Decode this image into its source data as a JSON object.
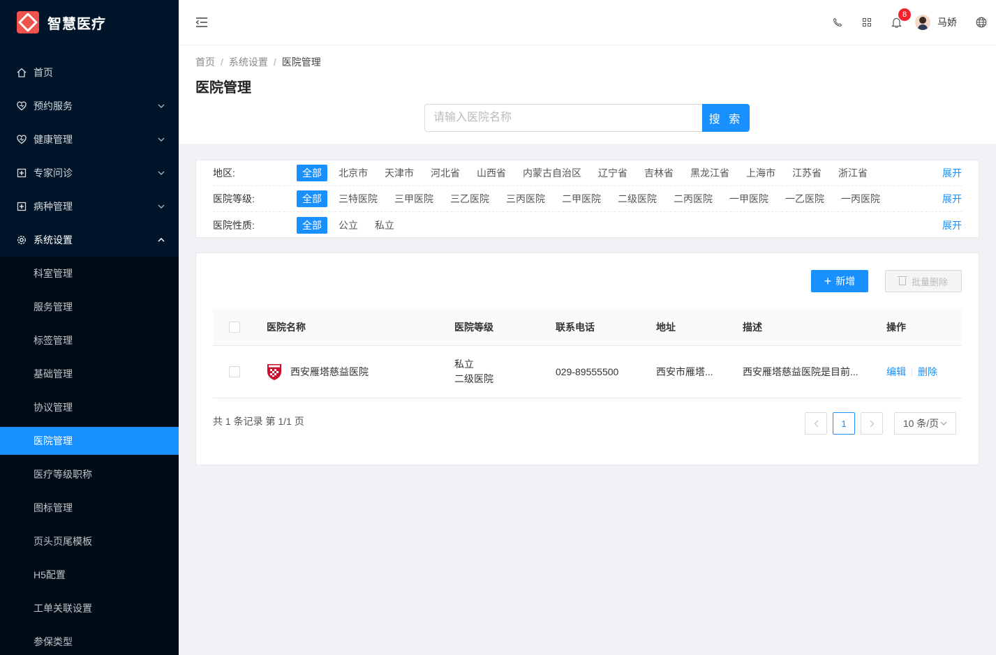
{
  "app": {
    "title": "智慧医疗"
  },
  "sidebar": {
    "items": [
      {
        "label": "首页",
        "icon": "home-icon"
      },
      {
        "label": "预约服务",
        "icon": "heart-shield-icon"
      },
      {
        "label": "健康管理",
        "icon": "heart-pulse-icon"
      },
      {
        "label": "专家问诊",
        "icon": "medical-plus-icon"
      },
      {
        "label": "病种管理",
        "icon": "medical-plus-icon"
      },
      {
        "label": "系统设置",
        "icon": "gear-icon"
      }
    ],
    "sub_items": [
      {
        "label": "科室管理"
      },
      {
        "label": "服务管理"
      },
      {
        "label": "标签管理"
      },
      {
        "label": "基础管理"
      },
      {
        "label": "协议管理"
      },
      {
        "label": "医院管理",
        "active": true
      },
      {
        "label": "医疗等级职称"
      },
      {
        "label": "图标管理"
      },
      {
        "label": "页头页尾模板"
      },
      {
        "label": "H5配置"
      },
      {
        "label": "工单关联设置"
      },
      {
        "label": "参保类型"
      }
    ]
  },
  "header": {
    "notification_count": "8",
    "user_name": "马娇"
  },
  "breadcrumb": {
    "home": "首页",
    "parent": "系统设置",
    "current": "医院管理"
  },
  "page": {
    "title": "医院管理"
  },
  "search": {
    "placeholder": "请输入医院名称",
    "button": "搜 索"
  },
  "filters": {
    "region": {
      "label": "地区:",
      "options": [
        "全部",
        "北京市",
        "天津市",
        "河北省",
        "山西省",
        "内蒙古自治区",
        "辽宁省",
        "吉林省",
        "黑龙江省",
        "上海市",
        "江苏省",
        "浙江省"
      ],
      "expand": "展开"
    },
    "level": {
      "label": "医院等级:",
      "options": [
        "全部",
        "三特医院",
        "三甲医院",
        "三乙医院",
        "三丙医院",
        "二甲医院",
        "二级医院",
        "二丙医院",
        "一甲医院",
        "一乙医院",
        "一丙医院"
      ],
      "expand": "展开"
    },
    "nature": {
      "label": "医院性质:",
      "options": [
        "全部",
        "公立",
        "私立"
      ],
      "expand": "展开"
    }
  },
  "toolbar": {
    "add_label": "新增",
    "batch_delete_label": "批量删除"
  },
  "table": {
    "columns": [
      "医院名称",
      "医院等级",
      "联系电话",
      "地址",
      "描述",
      "操作"
    ],
    "rows": [
      {
        "name": "西安雁塔慈益医院",
        "nature": "私立",
        "level": "二级医院",
        "phone": "029-89555500",
        "address": "西安市雁塔...",
        "desc": "西安雁塔慈益医院是目前...",
        "edit": "编辑",
        "delete": "删除"
      }
    ]
  },
  "pagination": {
    "summary": "共 1 条记录 第 1/1 页",
    "current": "1",
    "page_size": "10 条/页"
  },
  "colors": {
    "primary": "#1890ff",
    "sidebar_bg": "#001529",
    "badge": "#f5222d",
    "logo": "#f0524d"
  }
}
